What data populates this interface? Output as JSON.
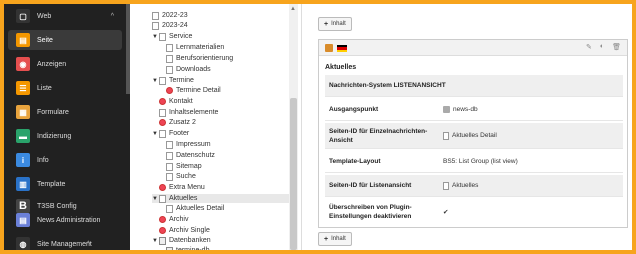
{
  "nav": {
    "items": [
      {
        "label": "Web",
        "icon": "web-icon",
        "chevron": "^",
        "color": "#333333",
        "glyph": "▢"
      },
      {
        "label": "Seite",
        "icon": "page-icon",
        "color": "#f49700",
        "glyph": "▤"
      },
      {
        "label": "Anzeigen",
        "icon": "view-icon",
        "color": "#e54f4f",
        "glyph": "◉"
      },
      {
        "label": "Liste",
        "icon": "list-icon",
        "color": "#f49700",
        "glyph": "☰"
      },
      {
        "label": "Formulare",
        "icon": "form-icon",
        "color": "#e8a33d",
        "glyph": "▦"
      },
      {
        "label": "Indizierung",
        "icon": "index-icon",
        "color": "#2aa36b",
        "glyph": "▬"
      },
      {
        "label": "Info",
        "icon": "info-icon",
        "color": "#3b8ae0",
        "glyph": "i"
      },
      {
        "label": "Template",
        "icon": "template-icon",
        "color": "#2a72c8",
        "glyph": "▥"
      },
      {
        "label": "T3SB Config",
        "icon": "t3sb-icon",
        "color": "#444444",
        "glyph": "B"
      },
      {
        "label": "News Administration",
        "icon": "news-icon",
        "color": "#6b80d8",
        "glyph": "▤"
      },
      {
        "label": "Site Management",
        "icon": "site-management-icon",
        "chevron": "^",
        "color": "#333333",
        "glyph": "◍"
      }
    ]
  },
  "tree": {
    "rows": [
      {
        "label": "2022-23",
        "toggle": ""
      },
      {
        "label": "2023-24",
        "toggle": ""
      },
      {
        "label": "Service",
        "toggle": "▼"
      },
      {
        "label": "Lernmaterialien",
        "toggle": ""
      },
      {
        "label": "Berufsorientierung",
        "toggle": ""
      },
      {
        "label": "Downloads",
        "toggle": ""
      },
      {
        "label": "Termine",
        "toggle": "▼"
      },
      {
        "label": "Termine Detail",
        "toggle": ""
      },
      {
        "label": "Kontakt",
        "toggle": ""
      },
      {
        "label": "Inhaltselemente",
        "toggle": ""
      },
      {
        "label": "Zusatz 2",
        "toggle": ""
      },
      {
        "label": "Footer",
        "toggle": "▼"
      },
      {
        "label": "Impressum",
        "toggle": ""
      },
      {
        "label": "Datenschutz",
        "toggle": ""
      },
      {
        "label": "Sitemap",
        "toggle": ""
      },
      {
        "label": "Suche",
        "toggle": ""
      },
      {
        "label": "Extra Menu",
        "toggle": ""
      },
      {
        "label": "Aktuelles",
        "toggle": "▼"
      },
      {
        "label": "Aktuelles Detail",
        "toggle": ""
      },
      {
        "label": "Archiv",
        "toggle": ""
      },
      {
        "label": "Archiv Single",
        "toggle": ""
      },
      {
        "label": "Datenbanken",
        "toggle": "▼"
      },
      {
        "label": "termine-db",
        "toggle": ""
      }
    ]
  },
  "content": {
    "add_content_label": "Inhalt",
    "add_content_bottom_label": "Inhalt",
    "element": {
      "title": "Aktuelles",
      "properties": [
        {
          "key": "Nachrichten-System LISTENANSICHT",
          "value": ""
        },
        {
          "key": "Ausgangspunkt",
          "value": "news-db"
        },
        {
          "key": "Seiten-ID für Einzelnachrichten-Ansicht",
          "value": "Aktuelles Detail"
        },
        {
          "key": "Template-Layout",
          "value": "BS5: List Group (list view)"
        },
        {
          "key": "Seiten-ID für Listenansicht",
          "value": "Aktuelles"
        },
        {
          "key": "Überschreiben von Plugin-Einstellungen deaktivieren",
          "value": "✔"
        }
      ]
    }
  },
  "colors": {
    "accent": "#f7a41d",
    "nav_bg": "#212121"
  }
}
